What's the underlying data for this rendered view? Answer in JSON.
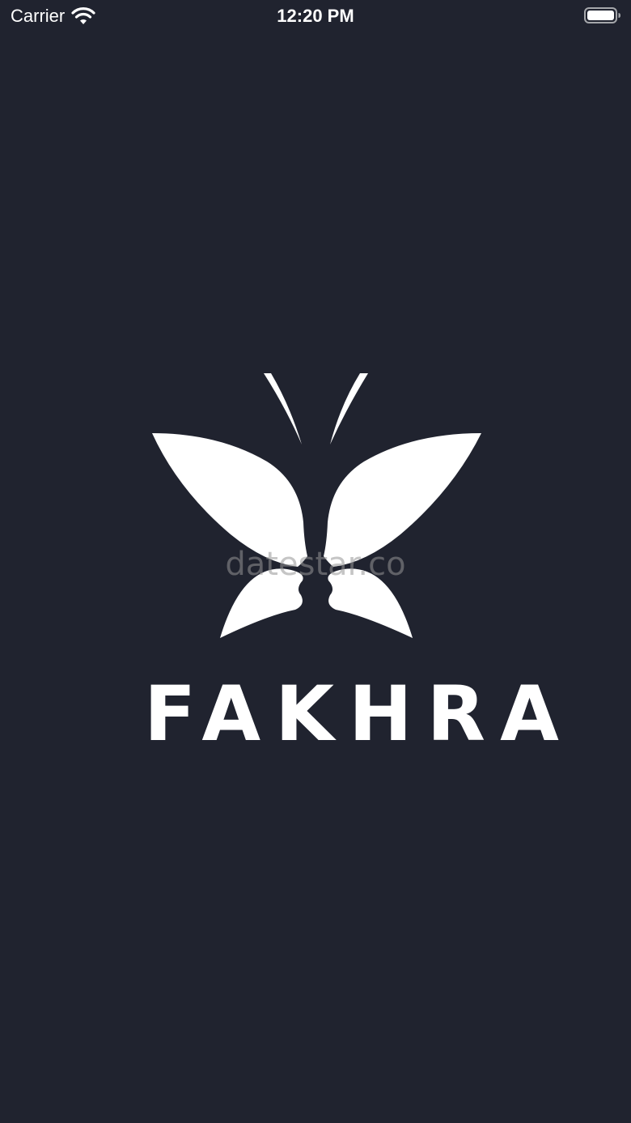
{
  "status_bar": {
    "carrier": "Carrier",
    "time": "12:20 PM",
    "icons": [
      "wifi-icon",
      "battery-icon"
    ]
  },
  "splash": {
    "brand_name": "FAKHRA",
    "logo_icon": "butterfly-faces-logo",
    "watermark": "datestar.co",
    "background_color": "#20232f",
    "foreground_color": "#ffffff"
  }
}
